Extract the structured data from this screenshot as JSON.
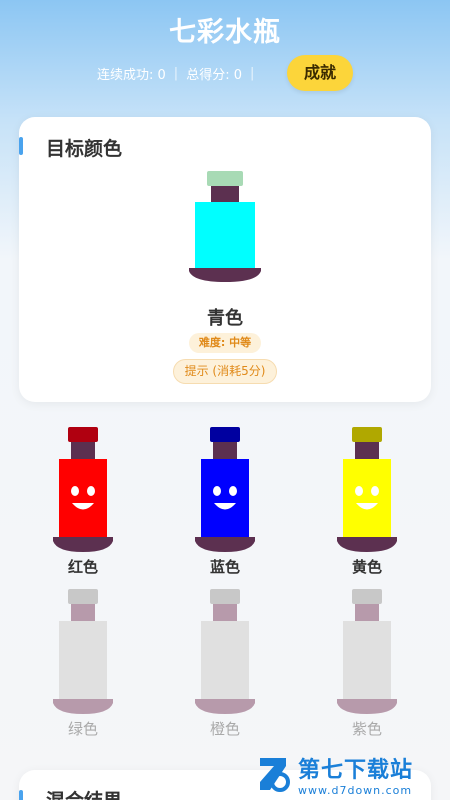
{
  "header": {
    "title": "七彩水瓶",
    "streak_label": "连续成功: 0",
    "score_label": "总得分: 0",
    "achievements_button": "成就"
  },
  "target": {
    "section_title": "目标颜色",
    "color_name": "青色",
    "difficulty": "难度: 中等",
    "hint_button": "提示 (消耗5分)",
    "liquid_color": "#00ffff",
    "cap_color": "#a8dab5"
  },
  "bottles": [
    {
      "label": "红色",
      "liquid_color": "#ff0000",
      "cap_color": "#b00010",
      "enabled": true
    },
    {
      "label": "蓝色",
      "liquid_color": "#0000ff",
      "cap_color": "#0000a0",
      "enabled": true
    },
    {
      "label": "黄色",
      "liquid_color": "#ffff00",
      "cap_color": "#b0a800",
      "enabled": true
    },
    {
      "label": "绿色",
      "liquid_color": "#e0e0e0",
      "cap_color": "#c8c8c8",
      "enabled": false
    },
    {
      "label": "橙色",
      "liquid_color": "#e0e0e0",
      "cap_color": "#c8c8c8",
      "enabled": false
    },
    {
      "label": "紫色",
      "liquid_color": "#e0e0e0",
      "cap_color": "#c8c8c8",
      "enabled": false
    }
  ],
  "result": {
    "section_title": "混合结果"
  },
  "watermark": {
    "name": "第七下载站",
    "url": "www.d7down.com"
  },
  "colors": {
    "accent_blue": "#4aa3ee",
    "button_yellow": "#fcd53a",
    "bottle_neck": "#5c3050",
    "bottle_base": "#5c3050"
  }
}
